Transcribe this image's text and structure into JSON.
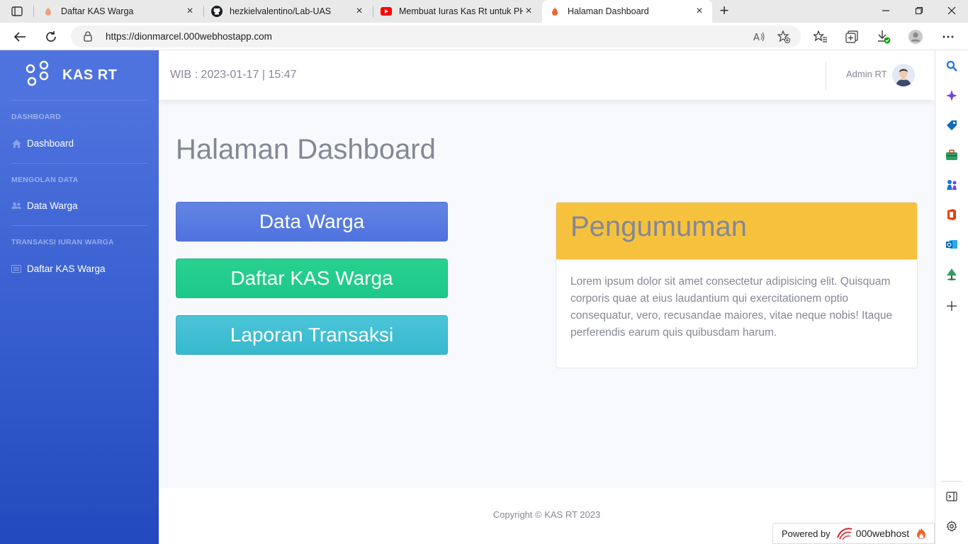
{
  "browser": {
    "tabs": [
      {
        "label": "Daftar KAS Warga",
        "icon": "fire-icon"
      },
      {
        "label": "hezkielvalentino/Lab-UAS",
        "icon": "github-icon"
      },
      {
        "label": "Membuat Iuras Kas Rt untuk PHP",
        "icon": "youtube-icon"
      },
      {
        "label": "Halaman Dashboard",
        "icon": "fire-icon"
      }
    ],
    "url": "https://dionmarcel.000webhostapp.com"
  },
  "sidebar": {
    "brand": "KAS RT",
    "sections": [
      {
        "heading": "DASHBOARD",
        "item": "Dashboard"
      },
      {
        "heading": "MENGOLAN DATA",
        "item": "Data Warga"
      },
      {
        "heading": "TRANSAKSI IURAN WARGA",
        "item": "Daftar KAS Warga"
      }
    ]
  },
  "topbar": {
    "clock": "WIB : 2023-01-17 | 15:47",
    "user": "Admin RT"
  },
  "main": {
    "title": "Halaman Dashboard",
    "buttons": [
      "Data Warga",
      "Daftar KAS Warga",
      "Laporan Transaksi"
    ],
    "announcement": {
      "title": "Pengumuman",
      "body": "Lorem ipsum dolor sit amet consectetur adipisicing elit. Quisquam corporis quae at eius laudantium qui exercitationem optio consequatur, vero, recusandae maiores, vitae neque nobis! Itaque perferendis earum quis quibusdam harum."
    }
  },
  "footer": {
    "copyright": "Copyright © KAS RT 2023",
    "powered_by": "Powered by",
    "host": "000webhost"
  },
  "colors": {
    "primary": "#4e73df",
    "success": "#1cc88a",
    "info": "#36b9cc",
    "warning": "#f6c23e",
    "text_muted": "#858796"
  }
}
